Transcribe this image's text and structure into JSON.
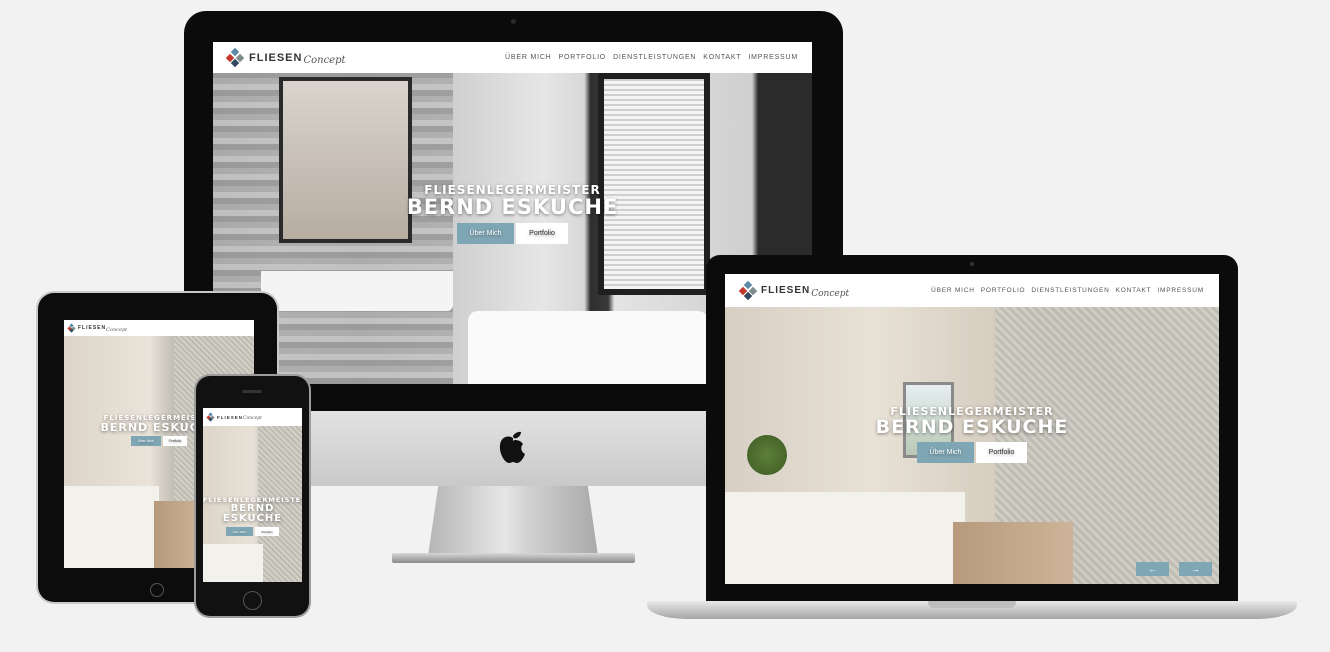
{
  "site": {
    "logo_word1": "Fliesen",
    "logo_word2": "Concept",
    "menu": [
      "Über mich",
      "Portfolio",
      "Dienstleistungen",
      "Kontakt",
      "Impressum"
    ],
    "hero_subtitle": "Fliesenlegermeister",
    "hero_name": "Bernd Eskuche",
    "hero_name_line1": "Bernd",
    "hero_name_line2": "Eskuche",
    "button_primary": "Über Mich",
    "button_secondary": "Portfolio",
    "slider_prev": "←",
    "slider_next": "→"
  },
  "colors": {
    "accent": "#7fa6b4",
    "logo_tiles": [
      "#c0392b",
      "#7f8c8d",
      "#5d8aa8",
      "#34495e"
    ]
  },
  "devices": [
    "desktop-imac",
    "laptop-macbook",
    "tablet-ipad",
    "phone-iphone"
  ]
}
